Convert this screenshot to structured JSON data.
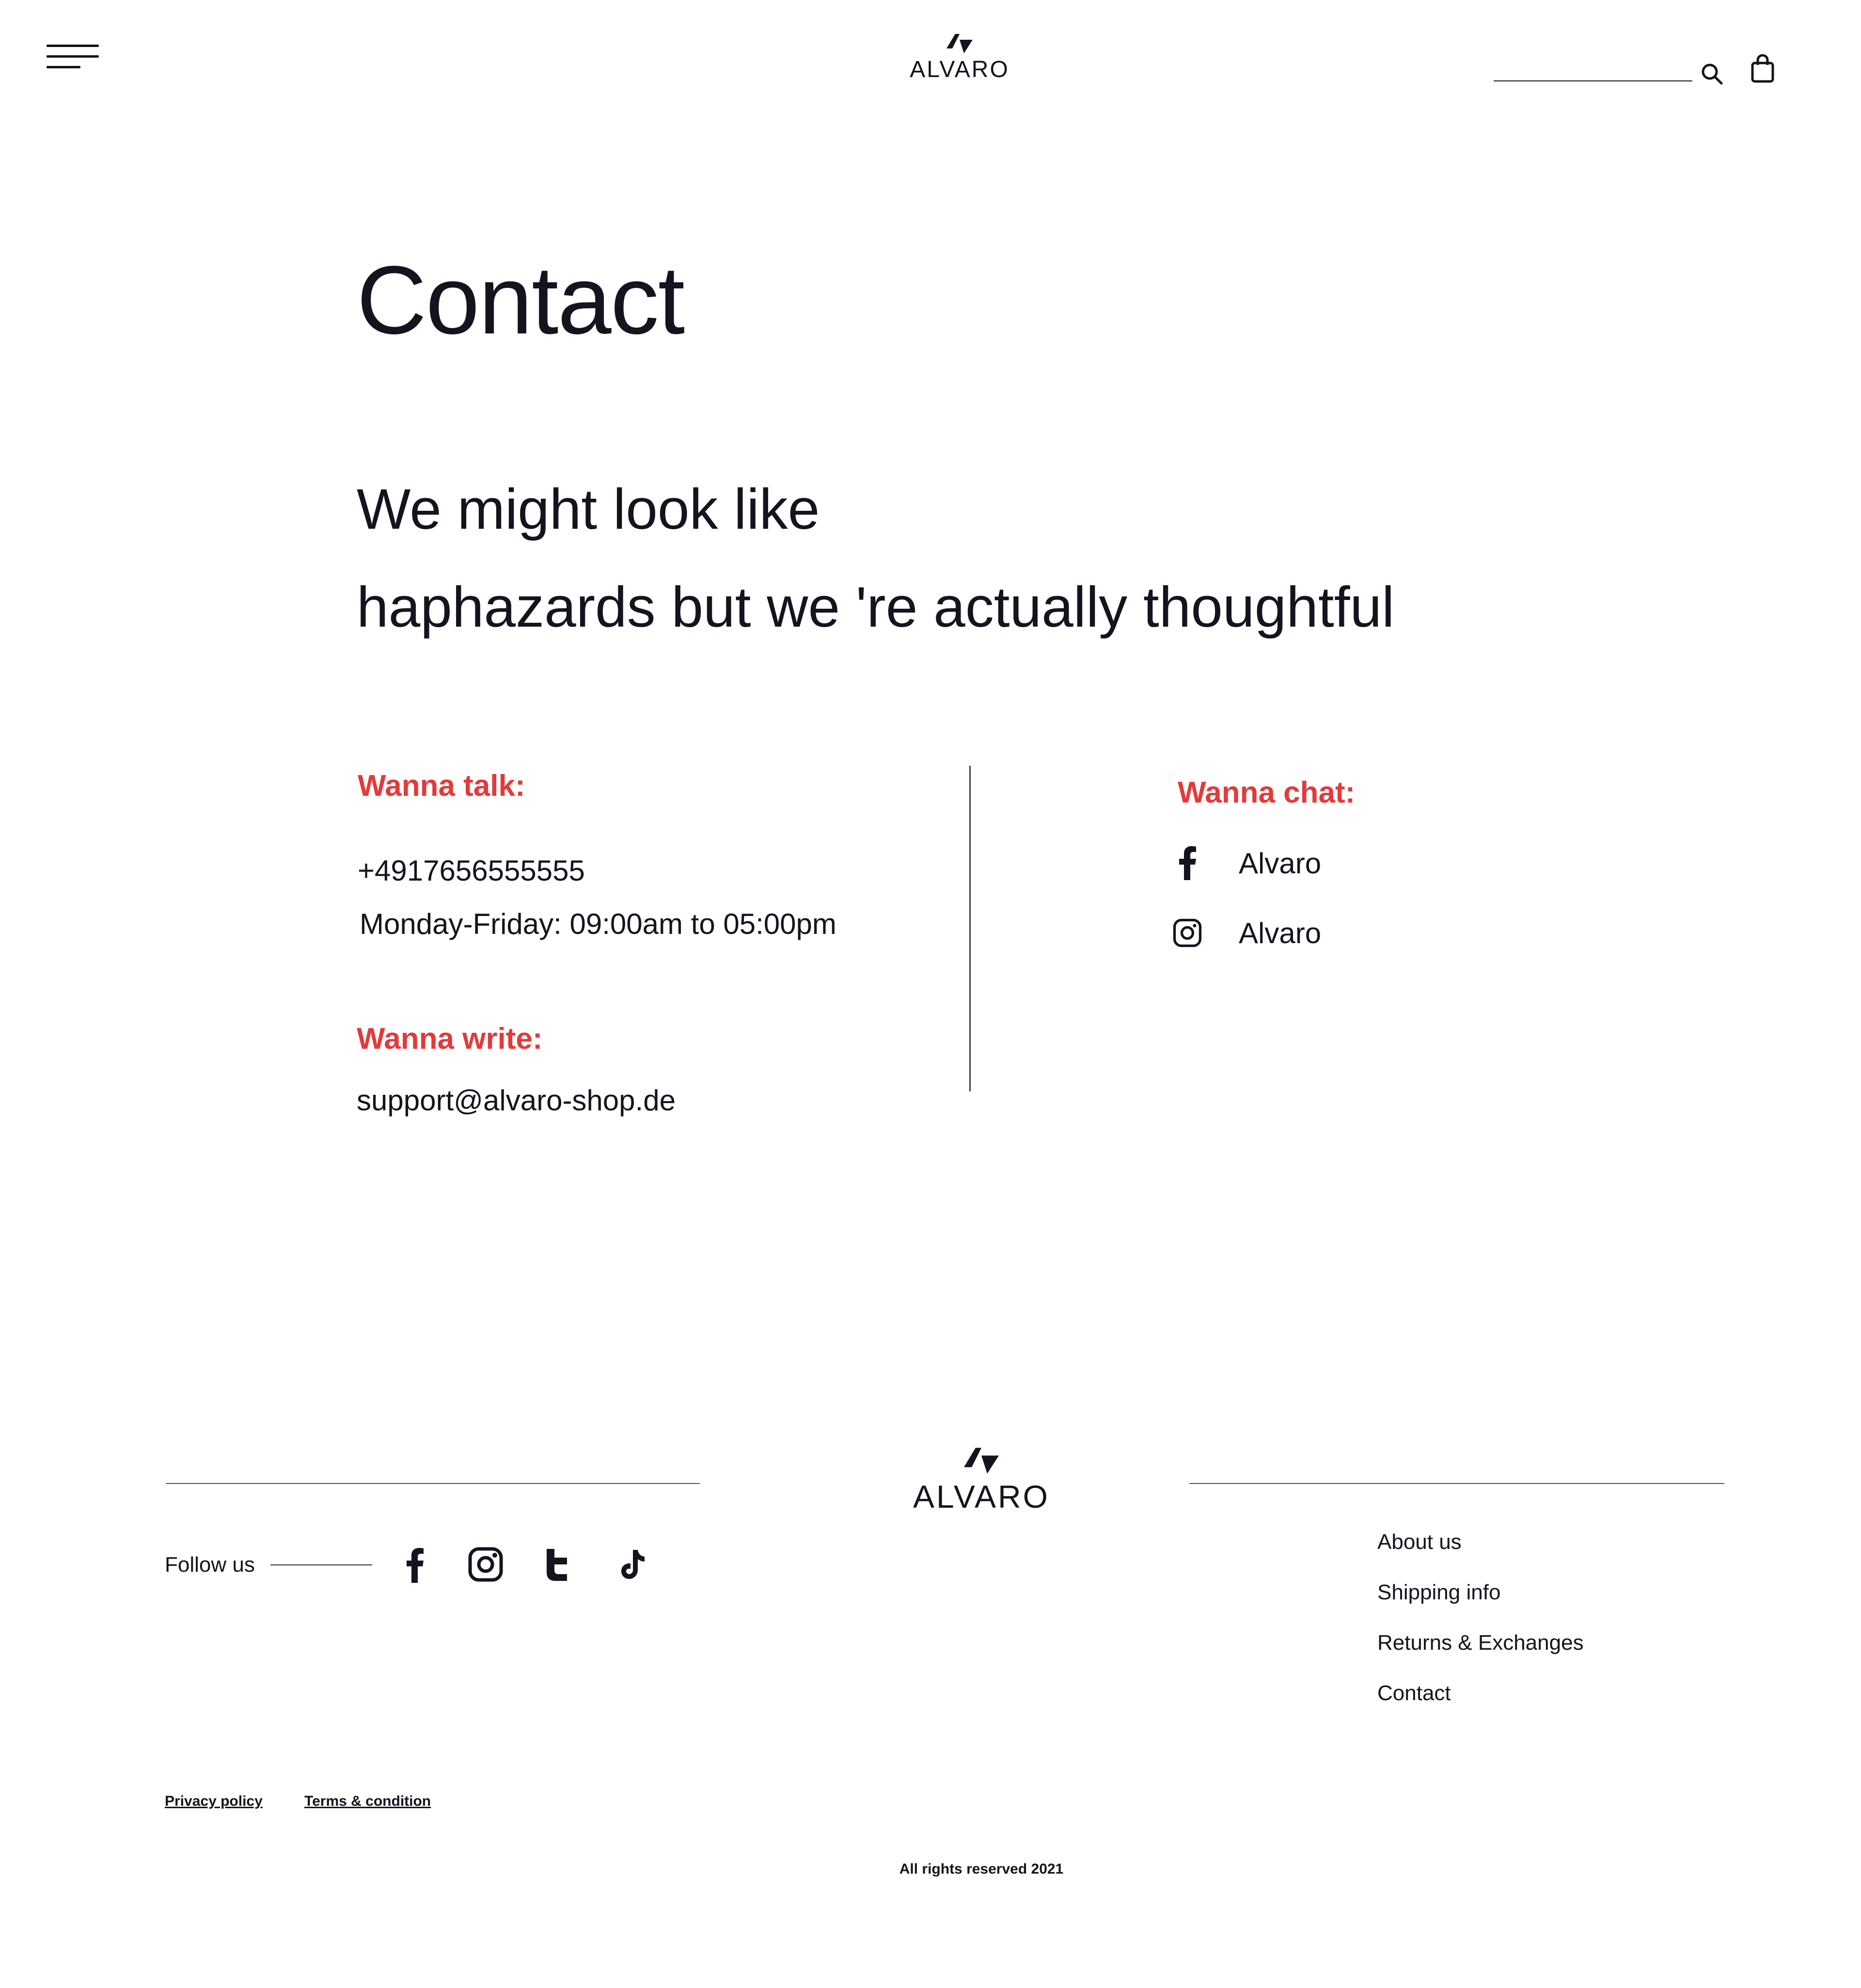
{
  "header": {
    "brand": "ALVARO",
    "search_placeholder": "",
    "icons": {
      "menu": "menu-icon",
      "search": "search-icon",
      "cart": "shopping-bag-icon",
      "logo": "alvaro-logo-mark"
    }
  },
  "main": {
    "title": "Contact",
    "tagline_line1": "We might look like",
    "tagline_line2": "haphazards but we 're actually thoughtful",
    "talk": {
      "heading": "Wanna talk:",
      "phone": "+4917656555555",
      "hours": "Monday-Friday: 09:00am to 05:00pm"
    },
    "write": {
      "heading": "Wanna write:",
      "email": "support@alvaro-shop.de"
    },
    "chat": {
      "heading": "Wanna chat:",
      "items": [
        {
          "icon": "facebook-icon",
          "label": "Alvaro"
        },
        {
          "icon": "instagram-icon",
          "label": "Alvaro"
        }
      ]
    }
  },
  "footer": {
    "brand": "ALVARO",
    "follow_label": "Follow us",
    "social_icons": [
      "facebook-icon",
      "instagram-icon",
      "twitter-icon",
      "tiktok-icon"
    ],
    "links": [
      "About us",
      "Shipping info",
      "Returns & Exchanges",
      "Contact"
    ],
    "privacy": "Privacy policy",
    "terms": "Terms & condition",
    "copyright": "All rights reserved 2021"
  },
  "colors": {
    "accent_red": "#e33a3a",
    "text_dark": "#14141f",
    "background": "#ffffff"
  }
}
